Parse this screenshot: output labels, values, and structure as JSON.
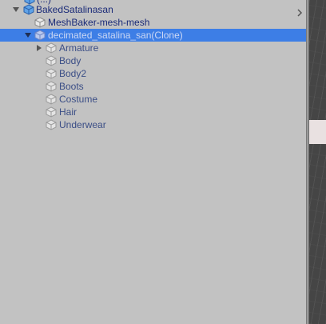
{
  "hierarchy": {
    "partial_top_label": "(...)",
    "rows": [
      {
        "label": "BakedSatalinasan",
        "style": "prefab"
      },
      {
        "label": "MeshBaker-mesh-mesh",
        "style": "prefab"
      },
      {
        "label": "decimated_satalina_san(Clone)",
        "style": "selected"
      },
      {
        "label": "Armature",
        "style": "dim"
      },
      {
        "label": "Body",
        "style": "dim"
      },
      {
        "label": "Body2",
        "style": "dim"
      },
      {
        "label": "Boots",
        "style": "dim"
      },
      {
        "label": "Costume",
        "style": "dim"
      },
      {
        "label": "Hair",
        "style": "dim"
      },
      {
        "label": "Underwear",
        "style": "dim"
      }
    ]
  },
  "icons": {
    "foldout_expanded": "triangle-down-icon",
    "foldout_collapsed": "triangle-right-icon",
    "gameobject": "cube-icon",
    "prefab_root": "blue-cube-icon",
    "row_menu": "chevron-right-icon"
  },
  "colors": {
    "panel_bg": "#c2c2c2",
    "selection": "#3d7ee6",
    "prefab_text": "#1a2a78",
    "scene_bg": "#454545"
  }
}
